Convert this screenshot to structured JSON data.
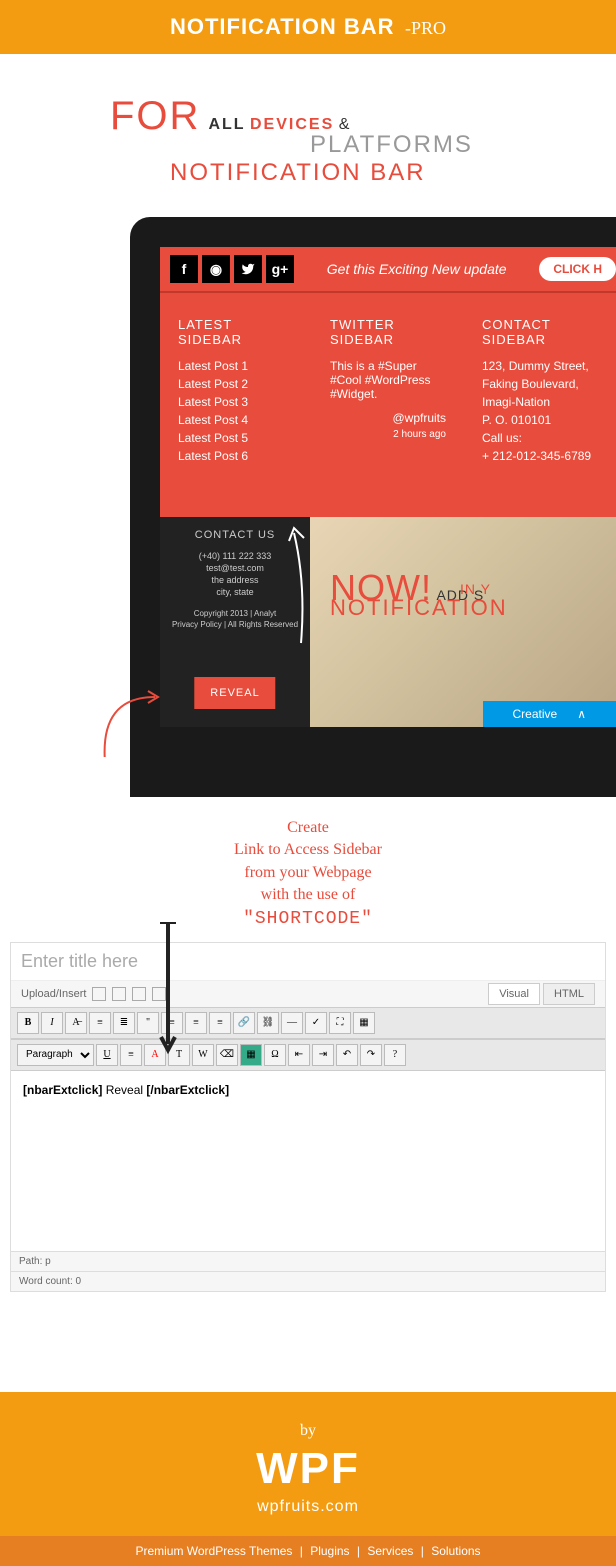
{
  "banner": {
    "title": "NOTIFICATION BAR",
    "pro": "-PRO"
  },
  "headline": {
    "for": "FOR",
    "all": "ALL",
    "devices": "DEVICES",
    "amp": "&",
    "platforms": "PLATFORMS",
    "sub": "NOTIFICATION BAR"
  },
  "notifBar": {
    "text": "Get this Exciting New update",
    "button": "CLICK H",
    "social": [
      "f",
      "◉",
      "t",
      "g+"
    ]
  },
  "sidebars": {
    "latest": {
      "title": "LATEST SIDEBAR",
      "items": [
        "Latest Post 1",
        "Latest Post 2",
        "Latest Post 3",
        "Latest Post 4",
        "Latest Post 5",
        "Latest Post 6"
      ]
    },
    "twitter": {
      "title": "TWITTER SIDEBAR",
      "tweet": "This is a #Super #Cool #WordPress #Widget.",
      "handle": "@wpfruits",
      "time": "2 hours ago"
    },
    "contact": {
      "title": "CONTACT SIDEBAR",
      "lines": [
        "123, Dummy Street,",
        "Faking Boulevard,",
        "Imagi-Nation",
        "P. O. 010101",
        "Call us:",
        "+ 212-012-345-6789"
      ]
    }
  },
  "contactPanel": {
    "title": "CONTACT US",
    "phone": "(+40) 111 222 333",
    "email": "test@test.com",
    "addr1": "the address",
    "addr2": "city, state",
    "copy": "Copyright 2013 | Analyt",
    "links": "Privacy Policy | All Rights Reserved",
    "reveal": "REVEAL"
  },
  "hero": {
    "now": "NOW!",
    "add": "ADD S",
    "iny": "IN Y",
    "nb": "NOTIFICATION",
    "creative": "Creative"
  },
  "annotation": {
    "l1": "Create",
    "l2": "Link to Access Sidebar",
    "l3": "from your Webpage",
    "l4": "with the use of",
    "shortcode": "\"SHORTCODE\""
  },
  "editor": {
    "titlePlaceholder": "Enter title here",
    "uploadLabel": "Upload/Insert",
    "visualTab": "Visual",
    "htmlTab": "HTML",
    "paragraph": "Paragraph",
    "content": {
      "open": "[nbarExtclick]",
      "mid": " Reveal ",
      "close": "[/nbarExtclick]"
    },
    "path": "Path: p",
    "wordCount": "Word count: 0"
  },
  "footer": {
    "by": "by",
    "wpf": "WPF",
    "url": "wpfruits.com",
    "links": [
      "Premium WordPress Themes",
      "Plugins",
      "Services",
      "Solutions"
    ]
  }
}
